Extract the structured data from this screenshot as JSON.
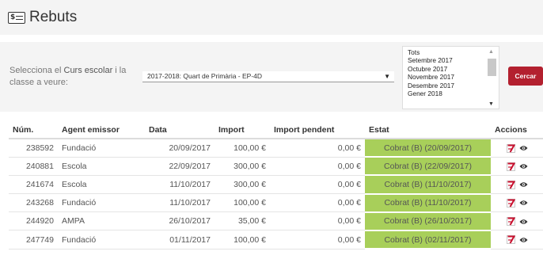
{
  "header": {
    "title": "Rebuts",
    "icon": "receipt-icon"
  },
  "filter": {
    "label_prefix": "Selecciona el ",
    "label_bold": "Curs escolar",
    "label_suffix": " i la classe a veure:",
    "course_value": "2017-2018: Quart de Primària - EP-4D",
    "months": [
      "Tots",
      "Setembre 2017",
      "Octubre 2017",
      "Novembre 2017",
      "Desembre 2017",
      "Gener 2018"
    ],
    "search_label": "Cercar",
    "accent": "#b3202f"
  },
  "table": {
    "columns": [
      "Núm.",
      "Agent emissor",
      "Data",
      "Import",
      "Import pendent",
      "Estat",
      "Accions"
    ],
    "rows": [
      {
        "num": "238592",
        "agent": "Fundació",
        "data": "20/09/2017",
        "import": "100,00 €",
        "pendent": "0,00 €",
        "estat": "Cobrat (B) (20/09/2017)"
      },
      {
        "num": "240881",
        "agent": "Escola",
        "data": "22/09/2017",
        "import": "300,00 €",
        "pendent": "0,00 €",
        "estat": "Cobrat (B) (22/09/2017)"
      },
      {
        "num": "241674",
        "agent": "Escola",
        "data": "11/10/2017",
        "import": "300,00 €",
        "pendent": "0,00 €",
        "estat": "Cobrat (B) (11/10/2017)"
      },
      {
        "num": "243268",
        "agent": "Fundació",
        "data": "11/10/2017",
        "import": "100,00 €",
        "pendent": "0,00 €",
        "estat": "Cobrat (B) (11/10/2017)"
      },
      {
        "num": "244920",
        "agent": "AMPA",
        "data": "26/10/2017",
        "import": "35,00 €",
        "pendent": "0,00 €",
        "estat": "Cobrat (B) (26/10/2017)"
      },
      {
        "num": "247749",
        "agent": "Fundació",
        "data": "01/11/2017",
        "import": "100,00 €",
        "pendent": "0,00 €",
        "estat": "Cobrat (B) (02/11/2017)"
      }
    ],
    "status_color": "#a8cf5a",
    "action_icons": [
      "pdf-icon",
      "eye-icon"
    ]
  }
}
